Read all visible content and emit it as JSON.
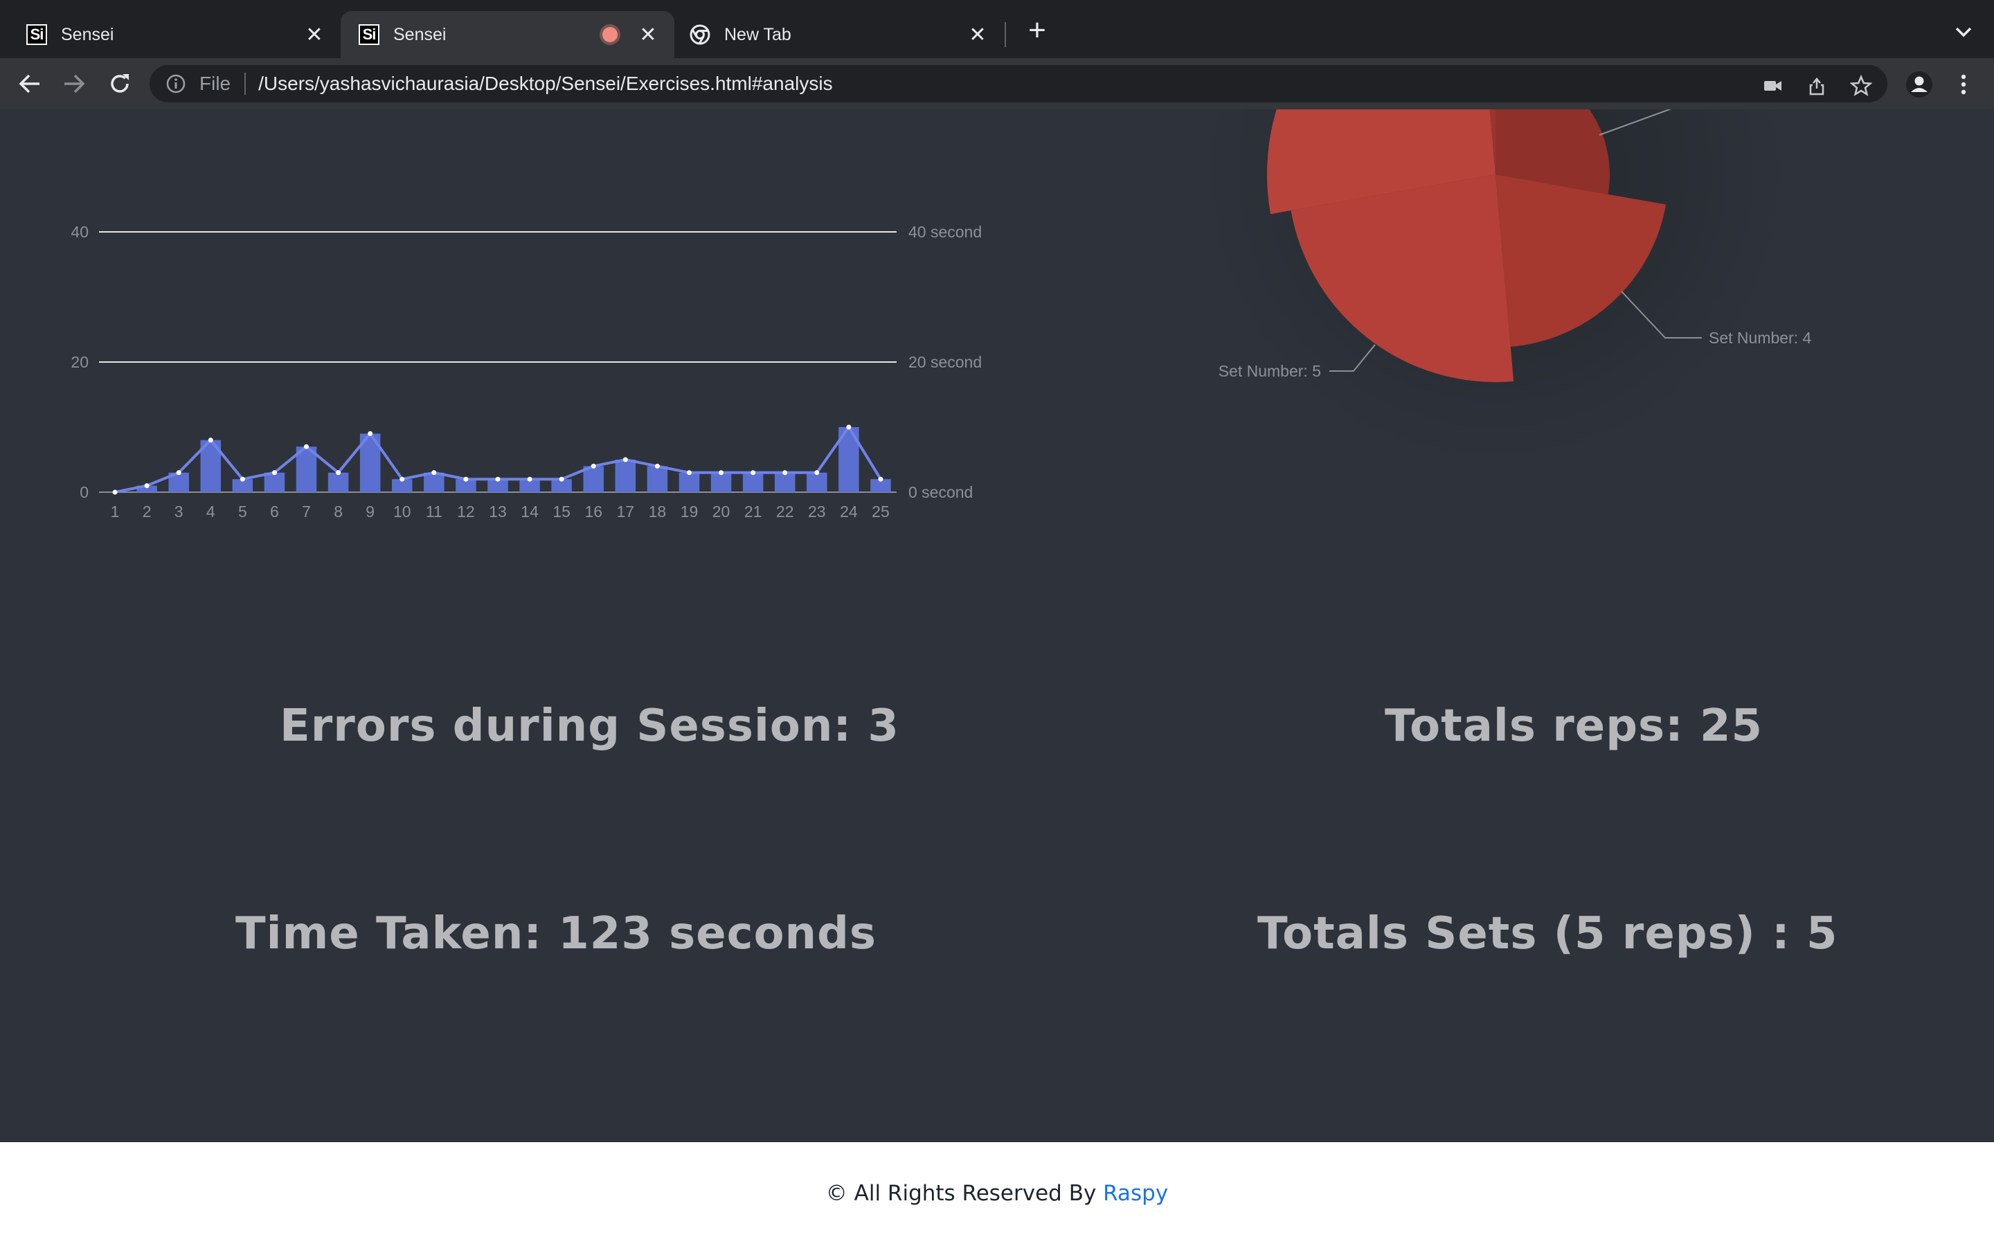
{
  "browser": {
    "tabs": [
      {
        "title": "Sensei",
        "active": false,
        "favicon": "sensei-icon"
      },
      {
        "title": "Sensei",
        "active": true,
        "favicon": "sensei-icon",
        "recording": true
      },
      {
        "title": "New Tab",
        "active": false,
        "favicon": "chrome-icon"
      }
    ],
    "omnibox": {
      "scheme_label": "File",
      "url": "/Users/yashasvichaurasia/Desktop/Sensei/Exercises.html#analysis"
    }
  },
  "colors": {
    "bar": "#5b6fd1",
    "line": "#6f83e8",
    "pie": "#b5403a",
    "background": "#2e333b",
    "link": "#1a73e8"
  },
  "chart_data": [
    {
      "type": "bar",
      "categories": [
        "1",
        "2",
        "3",
        "4",
        "5",
        "6",
        "7",
        "8",
        "9",
        "10",
        "11",
        "12",
        "13",
        "14",
        "15",
        "16",
        "17",
        "18",
        "19",
        "20",
        "21",
        "22",
        "23",
        "24",
        "25"
      ],
      "series": [
        {
          "values": [
            0,
            1,
            3,
            8,
            2,
            3,
            7,
            3,
            9,
            2,
            3,
            2,
            2,
            2,
            2,
            4,
            5,
            4,
            3,
            3,
            3,
            3,
            3,
            10,
            2
          ]
        }
      ],
      "line_overlay": true,
      "ylim": [
        0,
        40
      ],
      "yticks": [
        "0",
        "20",
        "40"
      ],
      "right_ticks": [
        "0 second",
        "20 second",
        "40 second"
      ],
      "grid": true
    },
    {
      "type": "pie",
      "labels": [
        "Set Number: 4",
        "Set Number: 5"
      ],
      "style": "rose"
    }
  ],
  "stats": {
    "errors": "Errors during Session: 3",
    "reps": "Totals reps: 25",
    "time": "Time Taken: 123 seconds",
    "sets": "Totals Sets (5 reps) : 5"
  },
  "footer": {
    "text": "© All Rights Reserved By ",
    "link": "Raspy"
  }
}
